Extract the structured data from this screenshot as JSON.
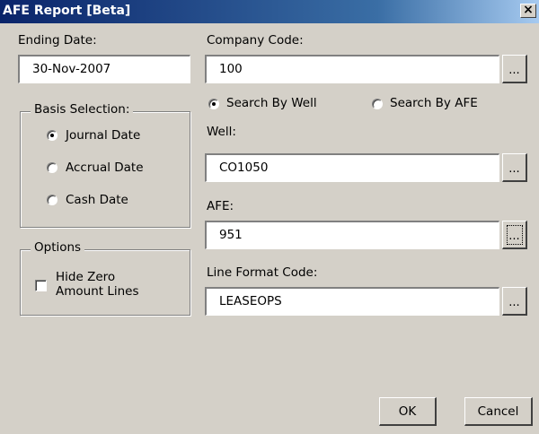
{
  "window": {
    "title": "AFE Report [Beta]",
    "close_glyph": "×"
  },
  "ending_date": {
    "label": "Ending Date:",
    "value": "30-Nov-2007"
  },
  "company_code": {
    "label": "Company Code:",
    "value": "100",
    "browse_label": "..."
  },
  "basis_selection": {
    "title": "Basis Selection:",
    "options": [
      {
        "label": "Journal Date",
        "checked": true
      },
      {
        "label": "Accrual Date",
        "checked": false
      },
      {
        "label": "Cash Date",
        "checked": false
      }
    ]
  },
  "search_mode": {
    "options": [
      {
        "label": "Search By Well",
        "checked": true
      },
      {
        "label": "Search By AFE",
        "checked": false
      }
    ]
  },
  "well": {
    "label": "Well:",
    "value": "CO1050",
    "browse_label": "..."
  },
  "afe": {
    "label": "AFE:",
    "value": "951",
    "browse_label": "..."
  },
  "options_group": {
    "title": "Options",
    "hide_zero_line1": "Hide Zero",
    "hide_zero_line2": "Amount Lines",
    "hide_zero_checked": false
  },
  "line_format": {
    "label": "Line Format Code:",
    "value": "LEASEOPS",
    "browse_label": "..."
  },
  "buttons": {
    "ok_label": "OK",
    "cancel_label": "Cancel"
  }
}
